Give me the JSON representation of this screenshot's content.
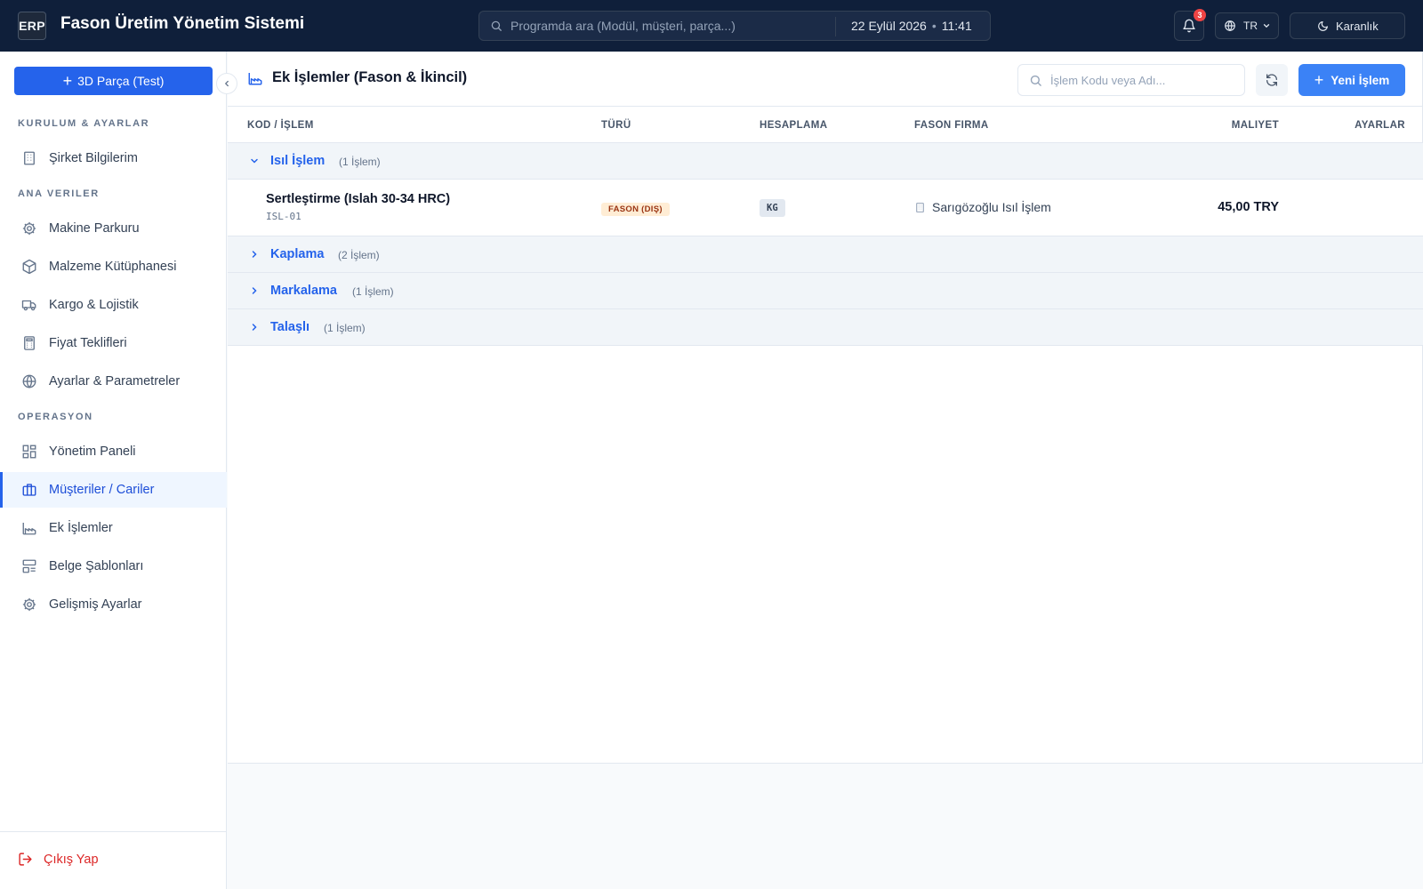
{
  "app": {
    "logo_text": "ERP",
    "title": "Fason Üretim Yönetim Sistemi"
  },
  "topbar": {
    "search_placeholder": "Programda ara (Modül, müşteri, parça...)",
    "date": "22 Eylül 2026",
    "separator": "•",
    "time": "11:41",
    "notification_count": "3",
    "language": "TR",
    "theme_label": "Karanlık"
  },
  "sidebar": {
    "primary_button": "3D Parça (Test)",
    "sections": [
      {
        "label": "KURULUM & AYARLAR",
        "items": [
          {
            "label": "Şirket Bilgilerim",
            "icon": "building-icon"
          }
        ]
      },
      {
        "label": "ANA VERILER",
        "items": [
          {
            "label": "Makine Parkuru",
            "icon": "gear-icon"
          },
          {
            "label": "Malzeme Kütüphanesi",
            "icon": "package-icon"
          },
          {
            "label": "Kargo & Lojistik",
            "icon": "truck-icon"
          },
          {
            "label": "Fiyat Teklifleri",
            "icon": "calculator-icon"
          },
          {
            "label": "Ayarlar & Parametreler",
            "icon": "globe-icon"
          }
        ]
      },
      {
        "label": "OPERASYON",
        "items": [
          {
            "label": "Yönetim Paneli",
            "icon": "dashboard-icon"
          },
          {
            "label": "Müşteriler / Cariler",
            "icon": "briefcase-icon",
            "active": true
          },
          {
            "label": "Ek İşlemler",
            "icon": "factory-icon"
          },
          {
            "label": "Belge Şablonları",
            "icon": "template-icon"
          },
          {
            "label": "Gelişmiş Ayarlar",
            "icon": "gear-icon"
          }
        ]
      }
    ],
    "logout_label": "Çıkış Yap"
  },
  "main": {
    "title": "Ek İşlemler (Fason & İkincil)",
    "search_placeholder": "İşlem Kodu veya Adı...",
    "new_button": "Yeni İşlem",
    "columns": {
      "code": "KOD / İŞLEM",
      "type": "TÜRÜ",
      "calc": "HESAPLAMA",
      "vendor": "FASON FIRMA",
      "cost": "MALIYET",
      "settings": "AYARLAR"
    },
    "groups": [
      {
        "name": "Isıl İşlem",
        "count": "(1 İşlem)",
        "expanded": true
      },
      {
        "name": "Kaplama",
        "count": "(2 İşlem)",
        "expanded": false
      },
      {
        "name": "Markalama",
        "count": "(1 İşlem)",
        "expanded": false
      },
      {
        "name": "Talaşlı",
        "count": "(1 İşlem)",
        "expanded": false
      }
    ],
    "rows": [
      {
        "name": "Sertleştirme (Islah 30-34 HRC)",
        "code": "ISL-01",
        "type": "FASON (DIŞ)",
        "calc": "KG",
        "vendor": "Sarıgözoğlu Isıl İşlem",
        "cost": "45,00 TRY"
      }
    ]
  },
  "colors": {
    "topbar_bg": "#0f1f3a",
    "accent": "#2563eb",
    "danger": "#dc2626",
    "badge_orange_bg": "#ffedd5"
  }
}
